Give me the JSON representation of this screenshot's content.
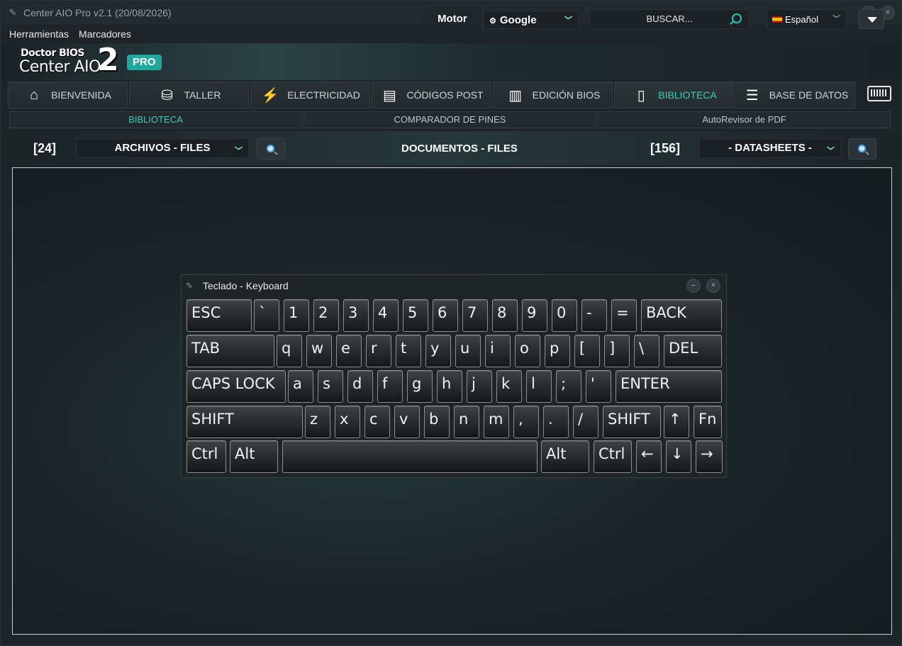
{
  "window": {
    "title": "Center AIO Pro v2.1 (20/08/2026)",
    "minimize": "–",
    "close": "×"
  },
  "menu": [
    "Herramientas",
    "Marcadores"
  ],
  "logo": {
    "line1": "Doctor BIOS",
    "line2": "Center AIO",
    "number": "2",
    "badge": "PRO"
  },
  "header": {
    "motor_label": "Motor",
    "engine_value": "Google",
    "search_placeholder": "BUSCAR...",
    "language": "Español"
  },
  "tabs": [
    {
      "label": "BIENVENIDA",
      "icon": "home-icon"
    },
    {
      "label": "TALLER",
      "icon": "usb-icon"
    },
    {
      "label": "ELECTRICIDAD",
      "icon": "lightning-icon"
    },
    {
      "label": "CÓDIGOS POST",
      "icon": "post-card-icon"
    },
    {
      "label": "EDICIÓN BIOS",
      "icon": "chip-icon"
    },
    {
      "label": "BIBLIOTECA",
      "icon": "book-icon",
      "active": true
    },
    {
      "label": "BASE DE DATOS",
      "icon": "database-icon"
    }
  ],
  "subtabs": [
    {
      "label": "BIBLIOTECA",
      "active": true
    },
    {
      "label": "COMPARADOR DE PINES"
    },
    {
      "label": "AutoRevisor de PDF"
    }
  ],
  "filter": {
    "files_count": "[24]",
    "files_select": "ARCHIVOS - FILES",
    "docs_title": "DOCUMENTOS - FILES",
    "datasheets_count": "[156]",
    "datasheets_select": "- DATASHEETS -"
  },
  "keyboard": {
    "title": "Teclado - Keyboard",
    "rows": [
      [
        "ESC",
        "`",
        "1",
        "2",
        "3",
        "4",
        "5",
        "6",
        "7",
        "8",
        "9",
        "0",
        "-",
        "=",
        "BACK"
      ],
      [
        "TAB",
        "q",
        "w",
        "e",
        "r",
        "t",
        "y",
        "u",
        "i",
        "o",
        "p",
        "[",
        "]",
        "\\",
        "DEL"
      ],
      [
        "CAPS LOCK",
        "a",
        "s",
        "d",
        "f",
        "g",
        "h",
        "j",
        "k",
        "l",
        ";",
        "'",
        "ENTER"
      ],
      [
        "SHIFT",
        "z",
        "x",
        "c",
        "v",
        "b",
        "n",
        "m",
        ",",
        ".",
        "/",
        "SHIFT",
        "↑",
        "Fn"
      ],
      [
        "Ctrl",
        "Alt",
        "",
        "Alt",
        "Ctrl",
        "←",
        "↓",
        "→"
      ]
    ]
  },
  "colors": {
    "accent": "#33d1bd",
    "background": "#1e2428"
  }
}
